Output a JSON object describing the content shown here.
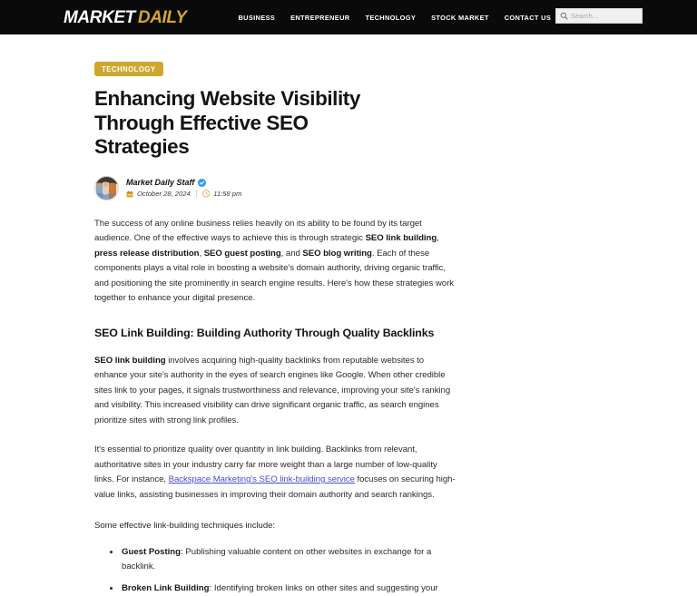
{
  "header": {
    "logo": {
      "part1": "MARKET",
      "part2": "DAILY"
    },
    "nav": [
      {
        "label": "BUSINESS"
      },
      {
        "label": "ENTREPRENEUR"
      },
      {
        "label": "TECHNOLOGY"
      },
      {
        "label": "STOCK MARKET"
      },
      {
        "label": "CONTACT US"
      }
    ],
    "search": {
      "placeholder": "Search...",
      "value": "",
      "icon": "search-icon"
    },
    "background_color": "#0a0a0a",
    "accent_color": "#d2a62c"
  },
  "article": {
    "category_badge": "TECHNOLOGY",
    "headline": "Enhancing Website Visibility Through Effective SEO Strategies",
    "author": {
      "name": "Market Daily Staff",
      "verified_icon": "verified-check-icon",
      "avatar_icon": "avatar-photo"
    },
    "meta": {
      "date_icon": "calendar-icon",
      "date": "October 28, 2024",
      "time_icon": "clock-icon",
      "time": "11:58 pm"
    },
    "paragraph_1": {
      "t1": "The success of any online business relies heavily on its ability to be found by its target audience. One of the effective ways to achieve this is through strategic ",
      "b1": "SEO link building",
      "t2": ", ",
      "b2": "press release distribution",
      "t3": ", ",
      "b3": "SEO guest posting",
      "t4": ", and ",
      "b4": "SEO blog writing",
      "t5": ". Each of these components plays a vital role in boosting a website's domain authority, driving organic traffic, and positioning the site prominently in search engine results. Here's how these strategies work together to enhance your digital presence."
    },
    "section_heading_1": "SEO Link Building: Building Authority Through Quality Backlinks",
    "paragraph_2": {
      "b1": "SEO link building",
      "t1": " involves acquiring high-quality backlinks from reputable websites to enhance your site's authority in the eyes of search engines like Google. When other credible sites link to your pages, it signals trustworthiness and relevance, improving your site's ranking and visibility. This increased visibility can drive significant organic traffic, as search engines prioritize sites with strong link profiles."
    },
    "paragraph_3": {
      "t1": "It's essential to prioritize quality over quantity in link building. Backlinks from relevant, authoritative sites in your industry carry far more weight than a large number of low-quality links. For instance, ",
      "link": "Backspace Marketing's SEO link-building service",
      "t2": " focuses on securing high-value links, assisting businesses in improving their domain authority and search rankings."
    },
    "list_intro": "Some effective link-building techniques include:",
    "bullets": [
      {
        "term": "Guest Posting",
        "text": ": Publishing valuable content on other websites in exchange for a backlink."
      },
      {
        "term": "Broken Link Building",
        "text": ": Identifying broken links on other sites and suggesting your"
      }
    ],
    "link_color": "#4a4ad6",
    "badge_color": "#cda72f"
  }
}
